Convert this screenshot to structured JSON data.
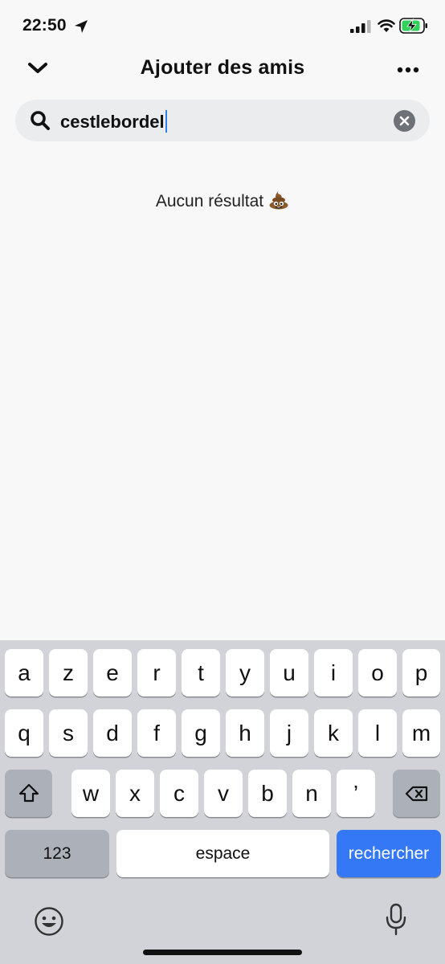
{
  "status_bar": {
    "time": "22:50"
  },
  "header": {
    "title": "Ajouter des amis"
  },
  "search": {
    "value": "cestlebordel"
  },
  "results": {
    "empty_message": "Aucun résultat"
  },
  "keyboard": {
    "row1": [
      "a",
      "z",
      "e",
      "r",
      "t",
      "y",
      "u",
      "i",
      "o",
      "p"
    ],
    "row2": [
      "q",
      "s",
      "d",
      "f",
      "g",
      "h",
      "j",
      "k",
      "l",
      "m"
    ],
    "row3": [
      "w",
      "x",
      "c",
      "v",
      "b",
      "n",
      "’"
    ],
    "numbers_label": "123",
    "space_label": "espace",
    "search_label": "rechercher"
  },
  "colors": {
    "accent": "#3478f6",
    "caret": "#2f80ed",
    "keyboard_bg": "#d1d3d9",
    "battery_green": "#30d158"
  },
  "icons": {
    "back": "chevron-down-icon",
    "more": "more-horizontal-icon",
    "search": "search-icon",
    "clear": "clear-circle-icon",
    "empty": "pile-of-poo-icon",
    "shift": "shift-icon",
    "delete": "backspace-icon",
    "emoji": "emoji-face-icon",
    "mic": "microphone-icon"
  }
}
